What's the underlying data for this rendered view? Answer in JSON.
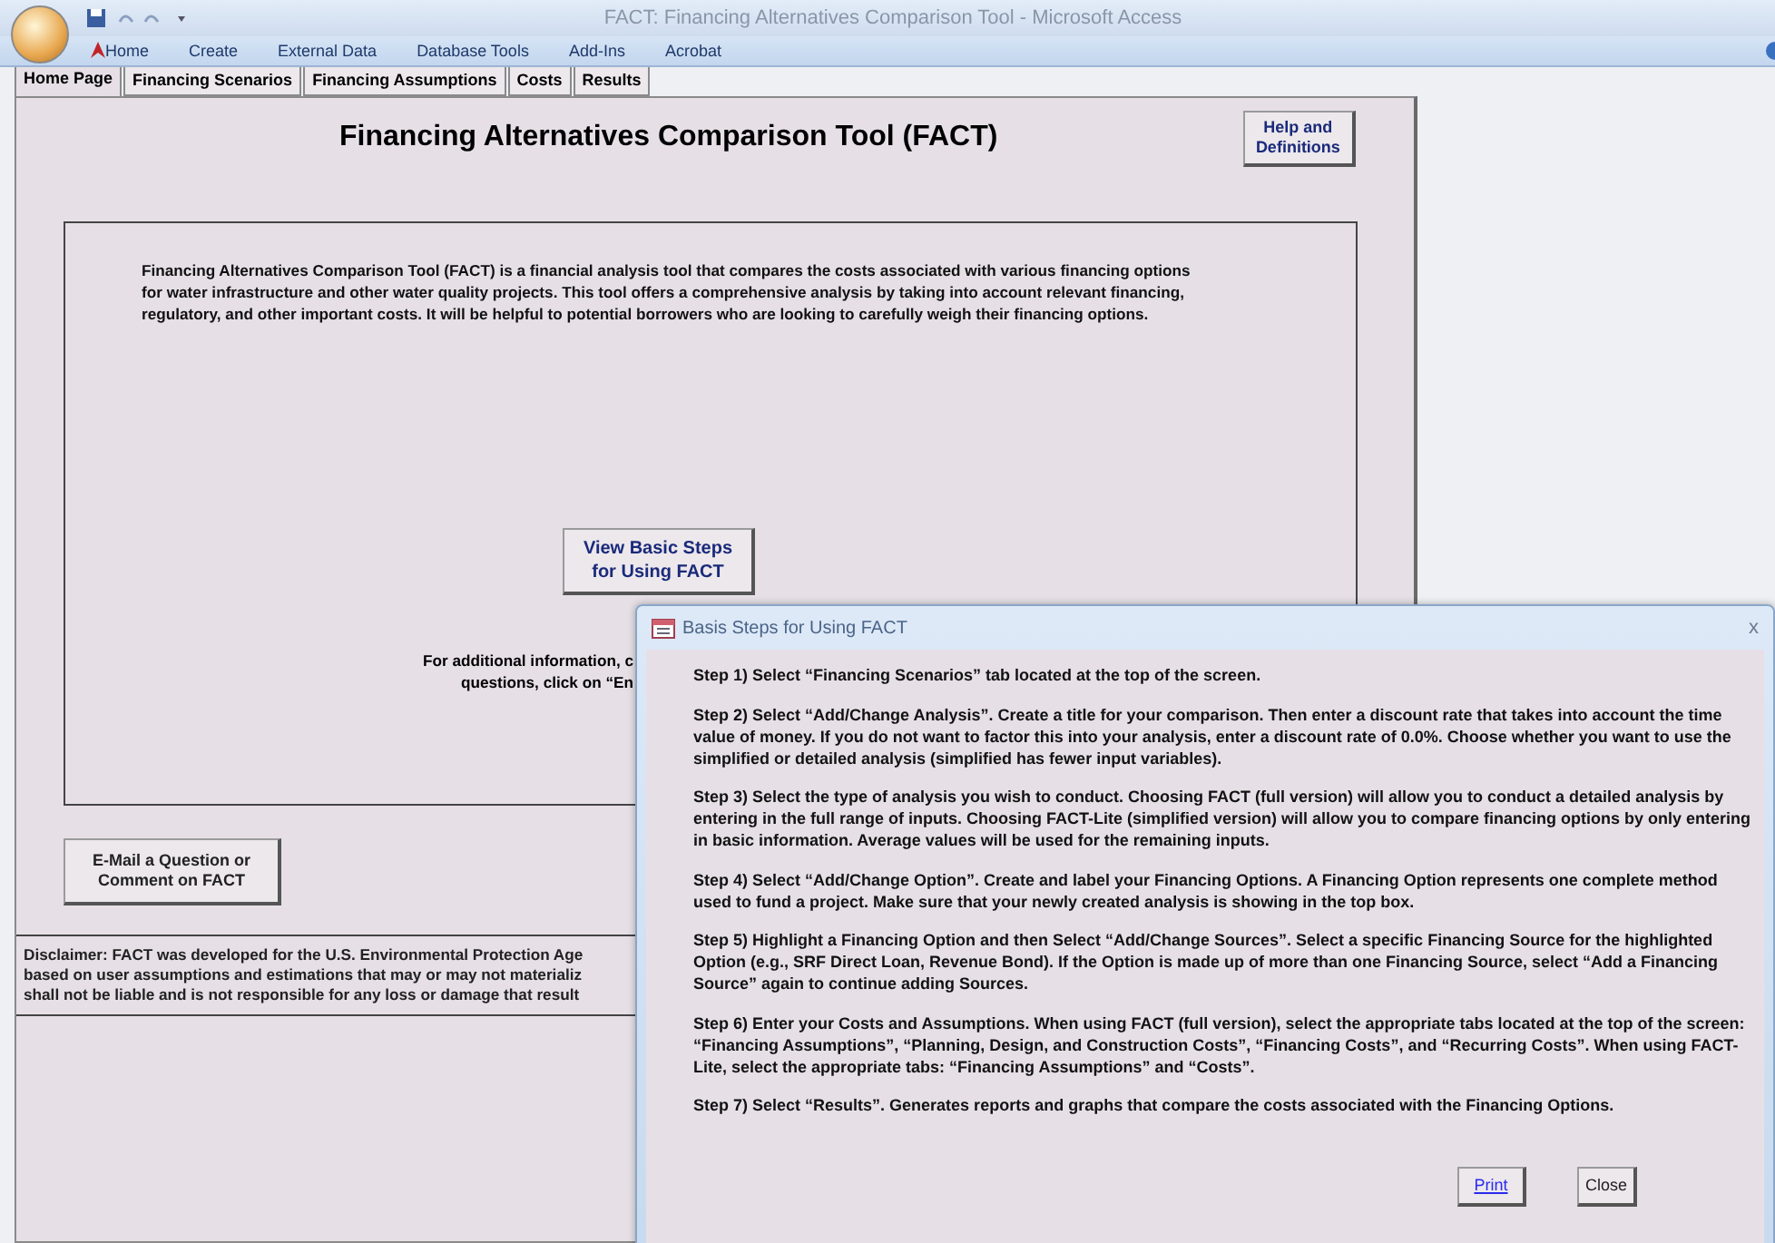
{
  "window": {
    "title": "FACT:  Financing Alternatives Comparison Tool - Microsoft Access"
  },
  "ribbon_tabs": [
    "Home",
    "Create",
    "External Data",
    "Database Tools",
    "Add-Ins",
    "Acrobat"
  ],
  "form_tabs": [
    {
      "label": "Home Page",
      "selected": true
    },
    {
      "label": "Financing Scenarios",
      "selected": false
    },
    {
      "label": "Financing Assumptions",
      "selected": false
    },
    {
      "label": "Costs",
      "selected": false
    },
    {
      "label": "Results",
      "selected": false
    }
  ],
  "home": {
    "heading": "Financing Alternatives Comparison Tool (FACT)",
    "help_button": "Help and Definitions",
    "intro": "Financing Alternatives Comparison Tool (FACT) is a financial analysis tool that compares the costs associated with various financing options for water infrastructure and other water quality projects.  This tool offers a comprehensive analysis by taking into account relevant financing, regulatory, and other important costs.  It will be helpful to potential borrowers who are looking to carefully weigh their financing options.",
    "steps_button": "View Basic Steps for Using FACT",
    "contact_lines": [
      "For additional information, c",
      "questions, click on “En"
    ],
    "email_button": "E-Mail a Question or Comment on FACT",
    "disclaimer_lines": [
      "Disclaimer:  FACT was developed for the U.S. Environmental Protection Age",
      "based on user assumptions and estimations that may or may not materializ",
      "shall not be liable and is not responsible for any loss or damage that result"
    ]
  },
  "dialog": {
    "title": "Basis Steps for Using FACT",
    "close_icon": "x",
    "steps": [
      "Step 1) Select “Financing Scenarios” tab located at the top of the screen.",
      "Step 2) Select “Add/Change Analysis”.  Create a title for your comparison.  Then enter a discount rate that takes into account the time value of money.  If you do not want to factor this into your analysis, enter a discount rate of 0.0%.  Choose whether you want to use the simplified or detailed analysis (simplified has fewer input variables).",
      "Step 3) Select the type of analysis you wish to conduct.  Choosing FACT (full version) will allow you to conduct a detailed analysis by entering in the full range of inputs.  Choosing FACT-Lite (simplified version) will allow you to compare financing options by only entering in basic information.  Average values will be used for the remaining inputs.",
      "Step 4) Select “Add/Change Option”.  Create and label your Financing Options.  A Financing Option represents one complete method used to fund a project.  Make sure that your newly created analysis is showing in the top box.",
      "Step 5) Highlight a Financing Option and then Select “Add/Change Sources”.  Select a specific Financing Source for the highlighted Option (e.g., SRF Direct Loan, Revenue Bond).  If the Option is made up of more than one Financing Source, select “Add a Financing Source” again to continue adding Sources.",
      "Step 6) Enter your Costs and Assumptions.  When using FACT (full version), select the appropriate tabs located at the top of the screen: “Financing Assumptions”, “Planning, Design, and Construction Costs”, “Financing Costs”, and “Recurring Costs”.  When using FACT-Lite, select the appropriate tabs: “Financing Assumptions” and “Costs”.",
      "Step 7) Select “Results”. Generates reports and graphs that compare the costs associated with the Financing Options."
    ],
    "print_button": "Print",
    "close_button": "Close"
  }
}
